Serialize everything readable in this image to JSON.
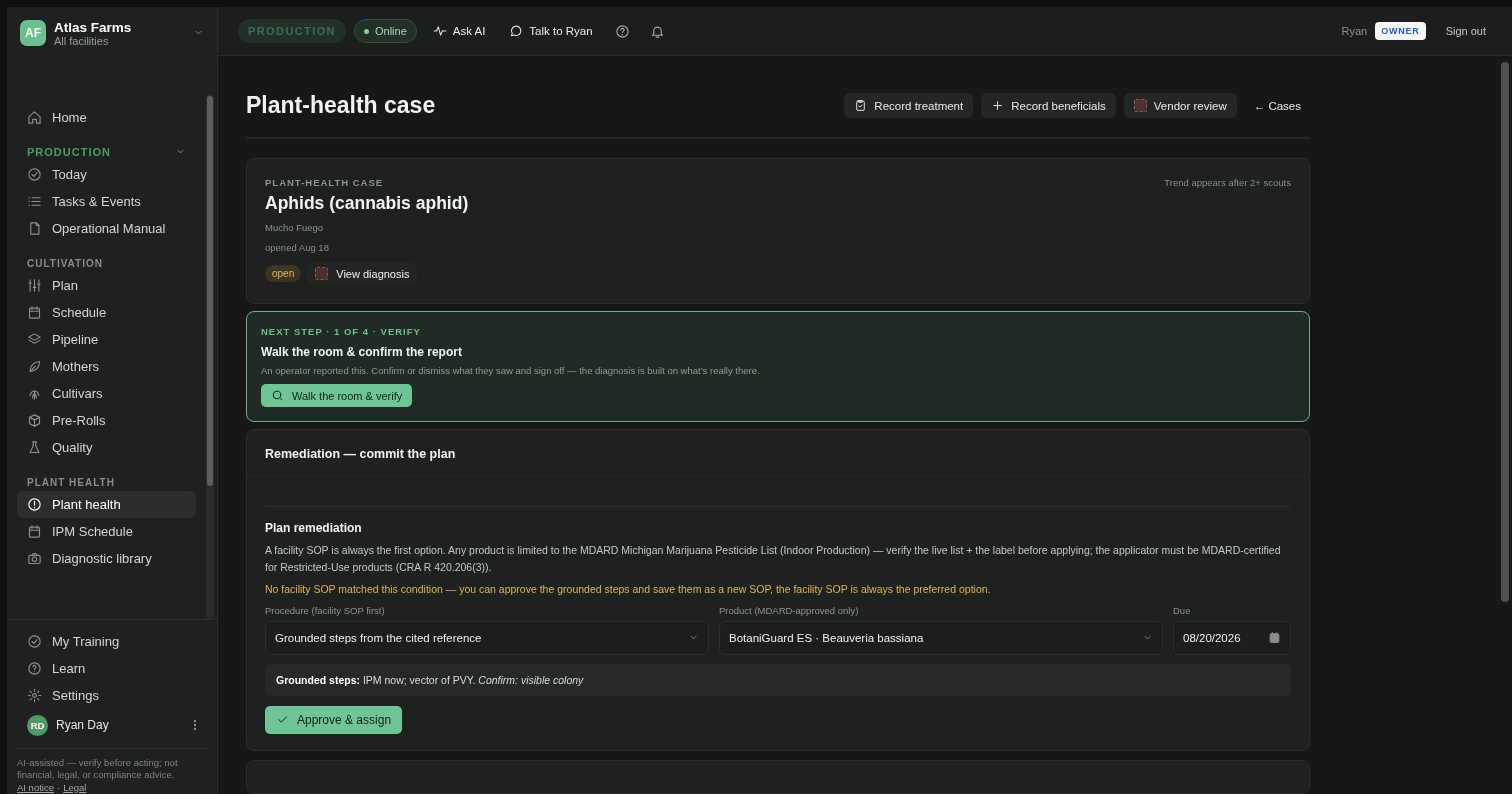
{
  "org": {
    "initials": "AF",
    "name": "Atlas Farms",
    "scope": "All facilities"
  },
  "sidebar": {
    "items": [
      {
        "label": "Home",
        "selected": false
      }
    ],
    "sections": [
      {
        "title": "PRODUCTION",
        "kind": "collapsible",
        "expanded": true,
        "items": [
          {
            "label": "Today",
            "selected": false
          },
          {
            "label": "Tasks & Events",
            "selected": false
          },
          {
            "label": "Operational Manual",
            "selected": false
          }
        ]
      },
      {
        "title": "CULTIVATION",
        "kind": "plain",
        "items": [
          {
            "label": "Plan",
            "selected": false
          },
          {
            "label": "Schedule",
            "selected": false
          },
          {
            "label": "Pipeline",
            "selected": false
          },
          {
            "label": "Mothers",
            "selected": false
          },
          {
            "label": "Cultivars",
            "selected": false
          },
          {
            "label": "Pre-Rolls",
            "selected": false
          },
          {
            "label": "Quality",
            "selected": false
          }
        ]
      },
      {
        "title": "PLANT HEALTH",
        "kind": "plain",
        "items": [
          {
            "label": "Plant health",
            "selected": true
          },
          {
            "label": "IPM Schedule",
            "selected": false
          },
          {
            "label": "Diagnostic library",
            "selected": false
          }
        ]
      }
    ],
    "footer_items": [
      {
        "label": "My Training"
      },
      {
        "label": "Learn"
      },
      {
        "label": "Settings"
      }
    ],
    "user": {
      "initials": "RD",
      "name": "Ryan Day"
    },
    "disclaimer": "AI-assisted — verify before acting; not financial, legal, or compliance advice.",
    "links": [
      "AI notice",
      "Legal"
    ],
    "separator": "·"
  },
  "topbar": {
    "mode": "PRODUCTION",
    "status": "Online",
    "online": true,
    "actions": [
      "Ask AI",
      "Talk to Ryan"
    ],
    "user": "Ryan",
    "role": "OWNER",
    "sign_out": "Sign out"
  },
  "page": {
    "title": "Plant-health case",
    "actions": [
      "Record treatment",
      "Record beneficials",
      "Vendor review"
    ],
    "back": "← Cases"
  },
  "case": {
    "eyebrow": "PLANT-HEALTH CASE",
    "title": "Aphids (cannabis aphid)",
    "cultivar": "Mucho Fuego",
    "opened": "opened Aug 18",
    "trend_note": "Trend appears after 2+ scouts",
    "status": "open",
    "diagnosis_button": "View diagnosis"
  },
  "next_step": {
    "eyebrow": "NEXT STEP · 1 OF 4 · VERIFY",
    "title": "Walk the room & confirm the report",
    "text": "An operator reported this. Confirm or dismiss what they saw and sign off — the diagnosis is built on what’s really there.",
    "button": "Walk the room & verify"
  },
  "remediation": {
    "title": "Remediation — commit the plan",
    "subtitle": "Plan remediation",
    "text": "A facility SOP is always the first option. Any product is limited to the MDARD Michigan Marijuana Pesticide List (Indoor Production) — verify the live list + the label before applying; the applicator must be MDARD-certified for Restricted-Use products (CRA R 420.206(3)).",
    "warning": "No facility SOP matched this condition — you can approve the grounded steps and save them as a new SOP, the facility SOP is always the preferred option.",
    "procedure": {
      "label": "Procedure (facility SOP first)",
      "value": "Grounded steps from the cited reference"
    },
    "product": {
      "label": "Product (MDARD-approved only)",
      "value": "BotaniGuard ES · Beauveria bassiana"
    },
    "due": {
      "label": "Due",
      "value": "08/20/2026"
    },
    "grounded_steps": "**Grounded steps:** IPM now; vector of PVY. *Confirm: visible colony*",
    "button": "Approve & assign"
  }
}
